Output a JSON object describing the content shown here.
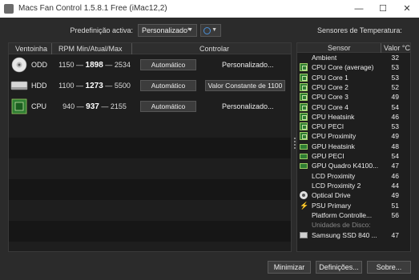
{
  "window": {
    "title": "Macs Fan Control 1.5.8.1 Free (iMac12,2)",
    "minimize_glyph": "—",
    "maximize_glyph": "☐",
    "close_glyph": "✕"
  },
  "preset": {
    "label": "Predefinição activa:",
    "selected": "Personalizado*",
    "arrow": "▼"
  },
  "sensors_title": "Sensores de Temperatura:",
  "fans": {
    "columns": [
      "Ventoinha",
      "RPM Min/Atual/Max",
      "Controlar"
    ],
    "rows": [
      {
        "name": "ODD",
        "icon": "optical-drive-icon",
        "min": "1150",
        "current": "1898",
        "max": "2534",
        "mode_button": "Automático",
        "control_text": "Personalizado..."
      },
      {
        "name": "HDD",
        "icon": "hard-drive-icon",
        "min": "1100",
        "current": "1273",
        "max": "5500",
        "mode_button": "Automático",
        "control_text": "Valor Constante de 1100"
      },
      {
        "name": "CPU",
        "icon": "cpu-chip-icon",
        "min": "940",
        "current": "937",
        "max": "2155",
        "mode_button": "Automático",
        "control_text": "Personalizado..."
      }
    ],
    "dash": "—"
  },
  "sensors": {
    "columns": [
      "Sensor",
      "Valor °C"
    ],
    "rows": [
      {
        "name": "Ambient",
        "value": "32",
        "icon": "none"
      },
      {
        "name": "CPU Core (average)",
        "value": "53",
        "icon": "cpu-icon"
      },
      {
        "name": "CPU Core 1",
        "value": "53",
        "icon": "cpu-icon"
      },
      {
        "name": "CPU Core 2",
        "value": "52",
        "icon": "cpu-icon"
      },
      {
        "name": "CPU Core 3",
        "value": "49",
        "icon": "cpu-icon"
      },
      {
        "name": "CPU Core 4",
        "value": "54",
        "icon": "cpu-icon"
      },
      {
        "name": "CPU Heatsink",
        "value": "46",
        "icon": "cpu-icon"
      },
      {
        "name": "CPU PECI",
        "value": "53",
        "icon": "cpu-icon"
      },
      {
        "name": "CPU Proximity",
        "value": "49",
        "icon": "cpu-icon"
      },
      {
        "name": "GPU Heatsink",
        "value": "48",
        "icon": "gpu-icon"
      },
      {
        "name": "GPU PECI",
        "value": "54",
        "icon": "gpu-icon"
      },
      {
        "name": "GPU Quadro K4100...",
        "value": "47",
        "icon": "gpu-icon"
      },
      {
        "name": "LCD Proximity",
        "value": "46",
        "icon": "none"
      },
      {
        "name": "LCD Proximity 2",
        "value": "44",
        "icon": "none"
      },
      {
        "name": "Optical Drive",
        "value": "49",
        "icon": "optical-drive-icon"
      },
      {
        "name": "PSU Primary",
        "value": "51",
        "icon": "power-bolt-icon"
      },
      {
        "name": "Platform Controlle...",
        "value": "56",
        "icon": "none"
      }
    ],
    "disk_section_label": "Unidades de Disco:",
    "disks": [
      {
        "name": "Samsung SSD 840 ...",
        "value": "47",
        "icon": "ssd-icon"
      }
    ]
  },
  "buttons": {
    "minimize": "Minimizar",
    "settings": "Definições...",
    "about": "Sobre..."
  },
  "colors": {
    "background": "#2b2b2b",
    "panel": "#1e1e1e",
    "accent_green": "#2e7d32",
    "accent_blue": "#4a90d9"
  }
}
